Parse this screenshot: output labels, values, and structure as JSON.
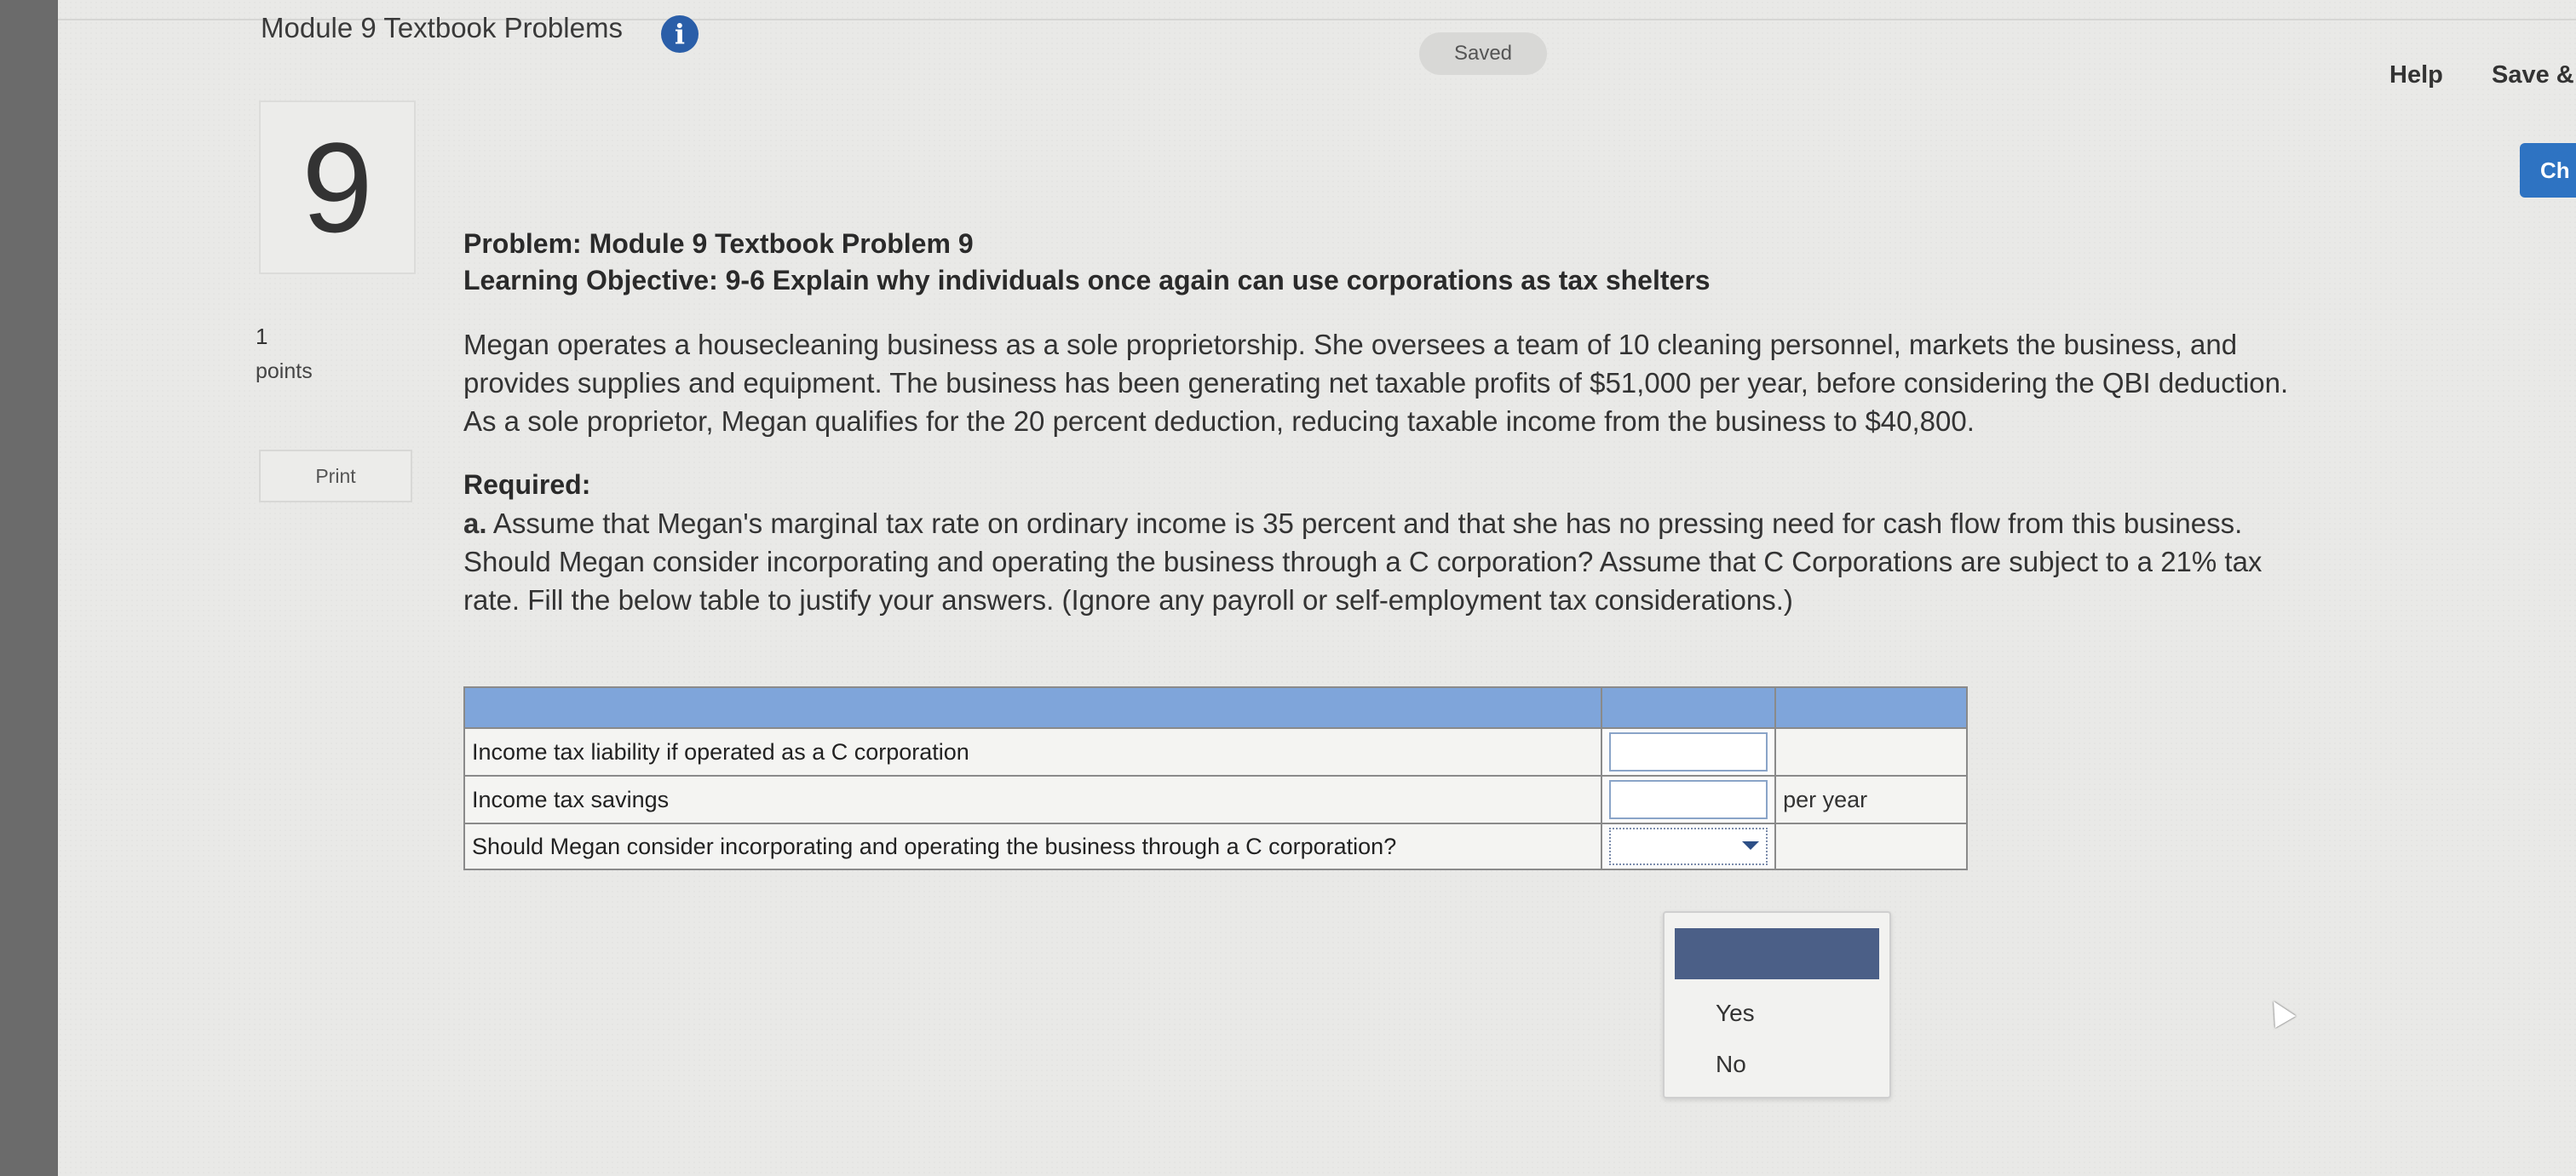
{
  "header": {
    "module_title": "Module 9 Textbook Problems",
    "info_icon": "info-icon",
    "saved_status": "Saved",
    "help_label": "Help",
    "save_label": "Save &",
    "check_label": "Ch"
  },
  "question": {
    "number": "9",
    "points_value": "1",
    "points_label": "points",
    "print_label": "Print"
  },
  "problem": {
    "title": "Problem: Module 9 Textbook Problem 9",
    "objective": "Learning Objective: 9-6 Explain why individuals once again can use corporations as tax shelters",
    "body": "Megan operates a housecleaning business as a sole proprietorship. She oversees a team of 10 cleaning personnel, markets the business, and provides supplies and equipment. The business has been generating net taxable profits of $51,000 per year, before considering the QBI deduction. As a sole proprietor, Megan qualifies for the 20 percent deduction, reducing taxable income from the business to $40,800.",
    "required_label": "Required:",
    "req_a_prefix": "a.",
    "req_a_text": "Assume that Megan's marginal tax rate on ordinary income is 35 percent and that she has no pressing need for cash flow from this business. Should Megan consider incorporating and operating the business through a C corporation? Assume that C Corporations are subject to a 21% tax rate. Fill the below table to justify your answers. (Ignore any payroll or self-employment tax considerations.)"
  },
  "table": {
    "rows": [
      {
        "label": "Income tax liability if operated as a C corporation",
        "value": "",
        "unit": ""
      },
      {
        "label": "Income tax savings",
        "value": "",
        "unit": "per year"
      },
      {
        "label": "Should Megan consider incorporating and operating the business through a C corporation?",
        "value": "",
        "unit": ""
      }
    ]
  },
  "dropdown": {
    "options": [
      "Yes",
      "No"
    ]
  }
}
